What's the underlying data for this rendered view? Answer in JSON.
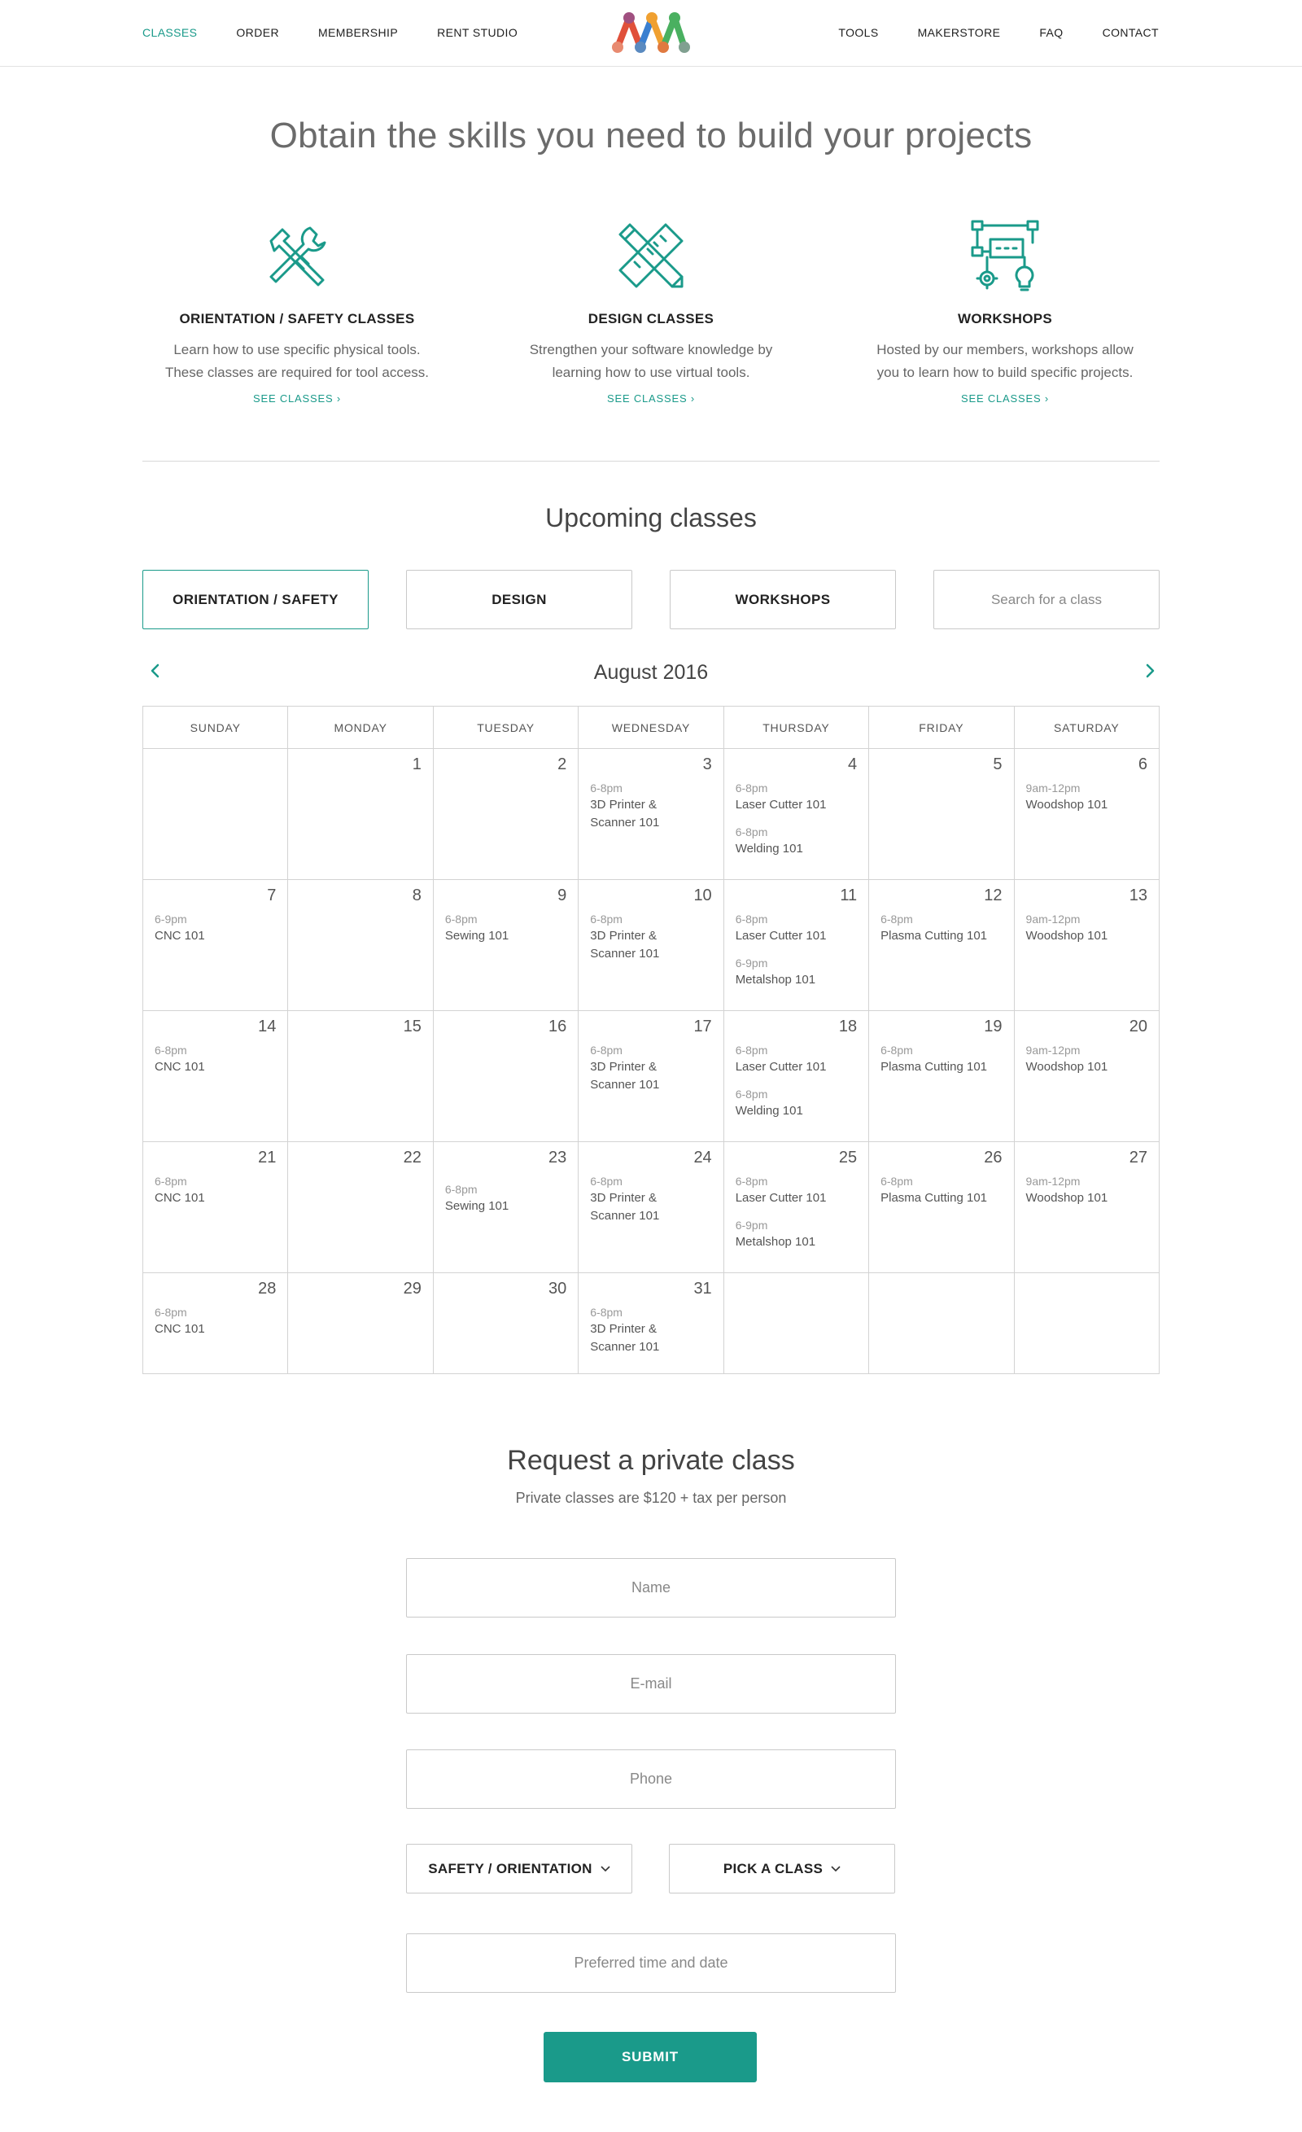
{
  "nav": {
    "left": [
      "CLASSES",
      "ORDER",
      "MEMBERSHIP",
      "RENT STUDIO"
    ],
    "right": [
      "TOOLS",
      "MAKERSTORE",
      "FAQ",
      "CONTACT"
    ],
    "logo_icon": "maker-logo-icon",
    "active": "CLASSES"
  },
  "hero": {
    "title": "Obtain the skills you need to build your projects"
  },
  "features": [
    {
      "icon": "tools-crossed-icon",
      "title": "ORIENTATION / SAFETY CLASSES",
      "line1": "Learn how to use specific physical tools.",
      "line2": "These classes are required for tool access.",
      "link": "SEE CLASSES ›"
    },
    {
      "icon": "pencil-ruler-icon",
      "title": "DESIGN CLASSES",
      "line1": "Strengthen your software knowledge by",
      "line2": "learning how to use virtual tools.",
      "link": "SEE CLASSES ›"
    },
    {
      "icon": "workshop-network-icon",
      "title": "WORKSHOPS",
      "line1": "Hosted by our members, workshops allow",
      "line2": "you to learn how to build specific projects.",
      "link": "SEE CLASSES ›"
    }
  ],
  "upcoming": {
    "title": "Upcoming classes",
    "filters": [
      "ORIENTATION / SAFETY",
      "DESIGN",
      "WORKSHOPS"
    ],
    "active_filter": "ORIENTATION / SAFETY",
    "search_placeholder": "Search for a class"
  },
  "calendar": {
    "month": "August 2016",
    "weekdays": [
      "SUNDAY",
      "MONDAY",
      "TUESDAY",
      "WEDNESDAY",
      "THURSDAY",
      "FRIDAY",
      "SATURDAY"
    ],
    "weeks": [
      [
        {
          "day": ""
        },
        {
          "day": "1"
        },
        {
          "day": "2"
        },
        {
          "day": "3",
          "events": [
            {
              "time": "6-8pm",
              "name": "3D Printer  &",
              "name2": "Scanner 101"
            }
          ]
        },
        {
          "day": "4",
          "events": [
            {
              "time": "6-8pm",
              "name": "Laser Cutter 101"
            },
            {
              "time": "6-8pm",
              "name": "Welding 101"
            }
          ]
        },
        {
          "day": "5"
        },
        {
          "day": "6",
          "events": [
            {
              "time": "9am-12pm",
              "name": "Woodshop 101"
            }
          ]
        }
      ],
      [
        {
          "day": "7",
          "events": [
            {
              "time": "6-9pm",
              "name": "CNC 101"
            }
          ]
        },
        {
          "day": "8"
        },
        {
          "day": "9",
          "events": [
            {
              "time": "6-8pm",
              "name": "Sewing 101"
            }
          ]
        },
        {
          "day": "10",
          "events": [
            {
              "time": "6-8pm",
              "name": "3D Printer  &",
              "name2": "Scanner 101"
            }
          ]
        },
        {
          "day": "11",
          "events": [
            {
              "time": "6-8pm",
              "name": "Laser Cutter 101"
            },
            {
              "time": "6-9pm",
              "name": "Metalshop 101"
            }
          ]
        },
        {
          "day": "12",
          "events": [
            {
              "time": "6-8pm",
              "name": "Plasma Cutting 101"
            }
          ]
        },
        {
          "day": "13",
          "events": [
            {
              "time": "9am-12pm",
              "name": "Woodshop 101"
            }
          ]
        }
      ],
      [
        {
          "day": "14",
          "events": [
            {
              "time": "6-8pm",
              "name": "CNC 101"
            }
          ]
        },
        {
          "day": "15"
        },
        {
          "day": "16"
        },
        {
          "day": "17",
          "events": [
            {
              "time": "6-8pm",
              "name": "3D Printer  &",
              "name2": "Scanner 101"
            }
          ]
        },
        {
          "day": "18",
          "events": [
            {
              "time": "6-8pm",
              "name": "Laser Cutter 101"
            },
            {
              "time": "6-8pm",
              "name": "Welding 101"
            }
          ]
        },
        {
          "day": "19",
          "events": [
            {
              "time": "6-8pm",
              "name": "Plasma Cutting 101"
            }
          ]
        },
        {
          "day": "20",
          "events": [
            {
              "time": "9am-12pm",
              "name": "Woodshop 101"
            }
          ]
        }
      ],
      [
        {
          "day": "21",
          "events": [
            {
              "time": "6-8pm",
              "name": "CNC 101"
            }
          ]
        },
        {
          "day": "22"
        },
        {
          "day": "23",
          "events": [
            {
              "time": "6-8pm",
              "name": "Sewing 101",
              "pad": true
            }
          ]
        },
        {
          "day": "24",
          "events": [
            {
              "time": "6-8pm",
              "name": "3D Printer  &",
              "name2": "Scanner 101"
            }
          ]
        },
        {
          "day": "25",
          "events": [
            {
              "time": "6-8pm",
              "name": "Laser Cutter 101"
            },
            {
              "time": "6-9pm",
              "name": "Metalshop 101"
            }
          ]
        },
        {
          "day": "26",
          "events": [
            {
              "time": "6-8pm",
              "name": "Plasma Cutting 101"
            }
          ]
        },
        {
          "day": "27",
          "events": [
            {
              "time": "9am-12pm",
              "name": "Woodshop 101"
            }
          ]
        }
      ],
      [
        {
          "day": "28",
          "events": [
            {
              "time": "6-8pm",
              "name": "CNC 101"
            }
          ]
        },
        {
          "day": "29"
        },
        {
          "day": "30"
        },
        {
          "day": "31",
          "events": [
            {
              "time": "6-8pm",
              "name": "3D Printer  &",
              "name2": "Scanner 101"
            }
          ]
        },
        {
          "day": ""
        },
        {
          "day": ""
        },
        {
          "day": ""
        }
      ]
    ]
  },
  "private": {
    "title": "Request a private class",
    "subtitle": "Private classes are $120 + tax per person",
    "name_placeholder": "Name",
    "email_placeholder": "E-mail",
    "phone_placeholder": "Phone",
    "category_select": "SAFETY / ORIENTATION",
    "class_select": "PICK A CLASS",
    "time_placeholder": "Preferred time and date",
    "submit": "SUBMIT"
  },
  "colors": {
    "accent": "#1a9a8a",
    "logo_red": "#e0503a",
    "logo_orange": "#f0a030",
    "logo_blue": "#3a7fd0",
    "logo_green": "#4ab060"
  }
}
